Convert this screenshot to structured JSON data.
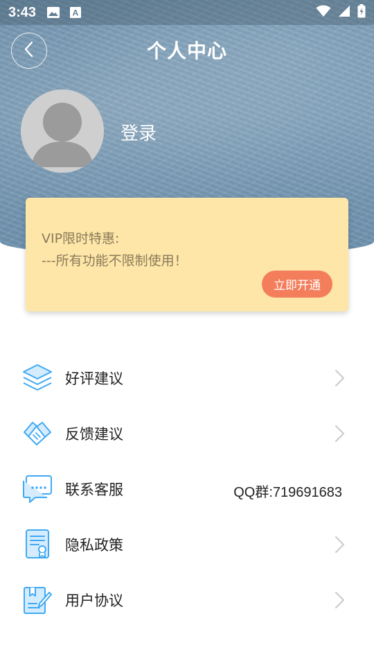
{
  "status_bar": {
    "time": "3:43",
    "left_icons": [
      "image-icon",
      "text-a-icon"
    ],
    "right_icons": [
      "wifi-icon",
      "signal-icon",
      "battery-charging-icon"
    ]
  },
  "header": {
    "title": "个人中心",
    "back_icon": "chevron-left-icon"
  },
  "profile": {
    "avatar": "default-avatar-icon",
    "login_label": "登录"
  },
  "vip_card": {
    "line1": "VIP限时特惠:",
    "line2": "---所有功能不限制使用！",
    "button_label": "立即开通",
    "background": "#fde6a8",
    "button_color": "#f47e5c"
  },
  "menu": {
    "items": [
      {
        "label": "好评建议",
        "icon": "layers-icon",
        "trailing": "chevron-right-icon"
      },
      {
        "label": "反馈建议",
        "icon": "handshake-icon",
        "trailing": "chevron-right-icon"
      },
      {
        "label": "联系客服",
        "icon": "chat-bubble-icon",
        "value": "QQ群:719691683"
      },
      {
        "label": "隐私政策",
        "icon": "document-certificate-icon",
        "trailing": "chevron-right-icon"
      },
      {
        "label": "用户协议",
        "icon": "agreement-edit-icon",
        "trailing": "chevron-right-icon"
      }
    ]
  },
  "colors": {
    "icon_blue": "#3fa9f5",
    "chevron": "#cccccc",
    "header_blue": "#7395b0"
  }
}
